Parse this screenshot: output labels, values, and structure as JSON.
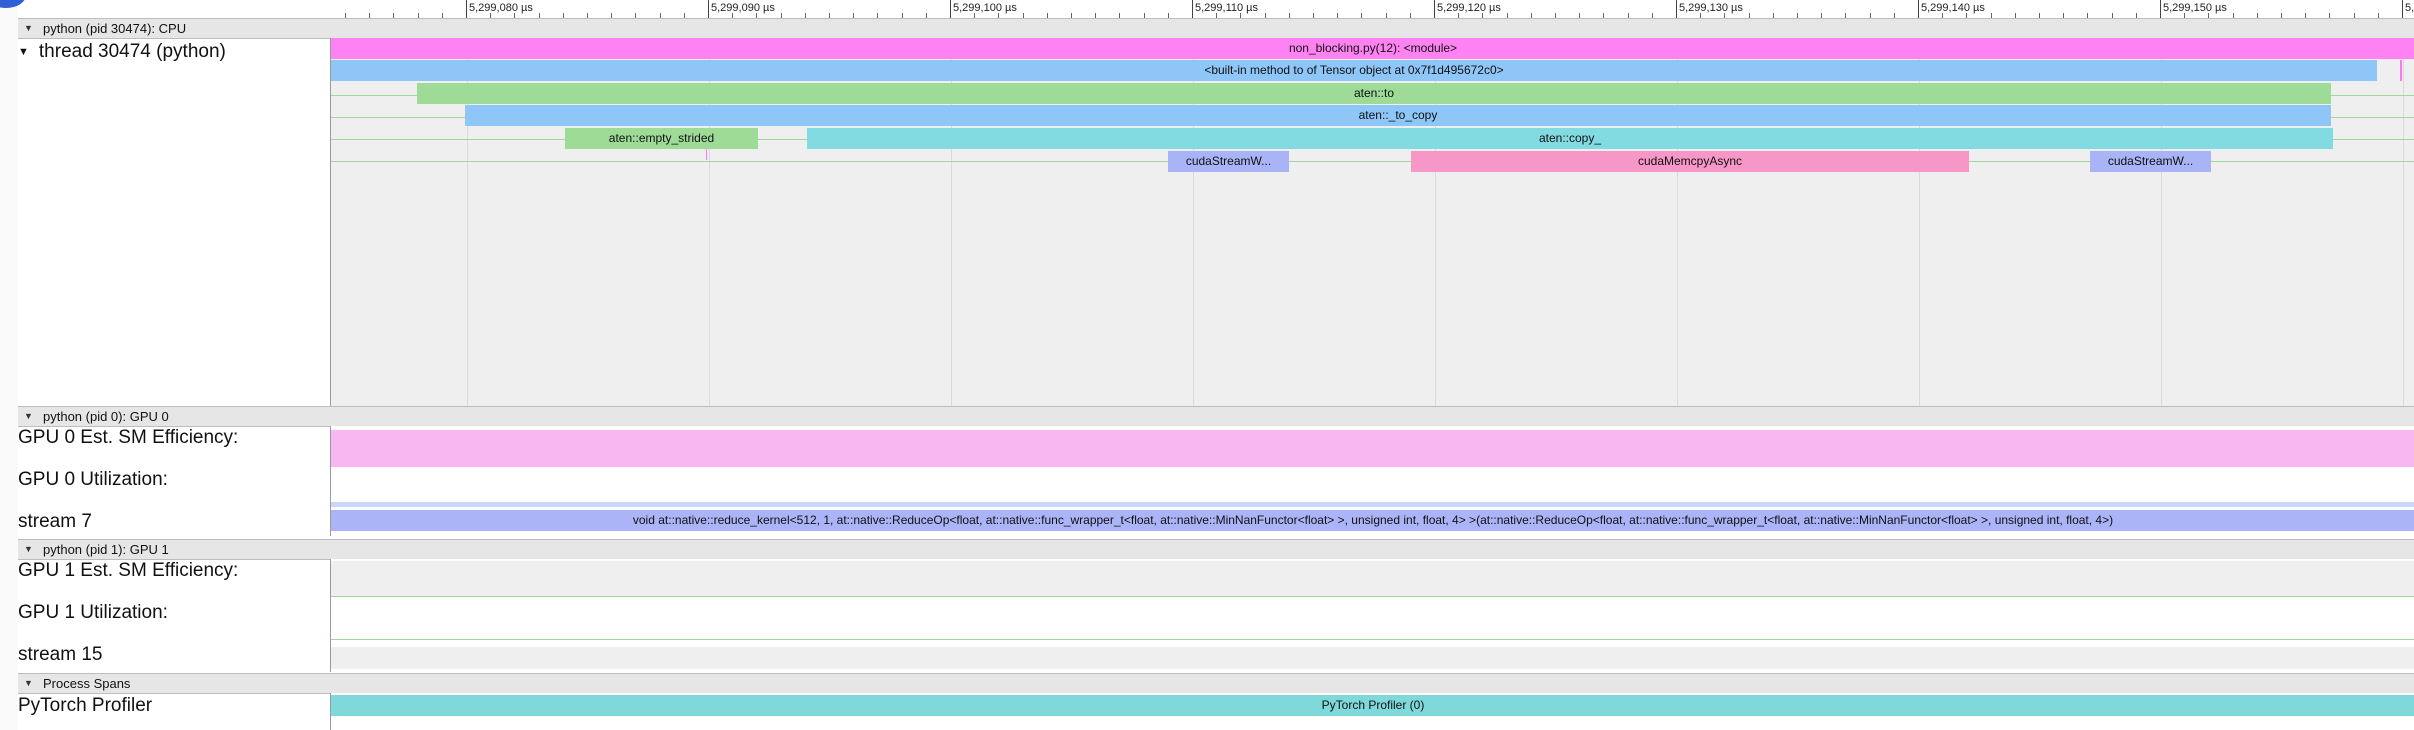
{
  "timeline": {
    "tick_labels": [
      "5,299,080 µs",
      "5,299,090 µs",
      "5,299,100 µs",
      "5,299,110 µs",
      "5,299,120 µs",
      "5,299,130 µs",
      "5,299,140 µs",
      "5,299,150 µs",
      "5,"
    ]
  },
  "sections": {
    "cpu": {
      "label": "python (pid 30474): CPU"
    },
    "gpu0": {
      "label": "python (pid 0): GPU 0"
    },
    "gpu1": {
      "label": "python (pid 1): GPU 1"
    },
    "spans": {
      "label": "Process Spans"
    }
  },
  "tracks": {
    "thread": {
      "label": "thread 30474 (python)"
    },
    "gpu0_sm": {
      "label": "GPU 0 Est. SM Efficiency:"
    },
    "gpu0_util": {
      "label": "GPU 0 Utilization:"
    },
    "stream7": {
      "label": "stream 7"
    },
    "gpu1_sm": {
      "label": "GPU 1 Est. SM Efficiency:"
    },
    "gpu1_util": {
      "label": "GPU 1 Utilization:"
    },
    "stream15": {
      "label": "stream 15"
    },
    "profiler": {
      "label": "PyTorch Profiler"
    }
  },
  "slices": {
    "module": "non_blocking.py(12): <module>",
    "to_method": "<built-in method to of Tensor object at 0x7f1d495672c0>",
    "aten_to": "aten::to",
    "aten_to_copy": "aten::_to_copy",
    "empty_strided": "aten::empty_strided",
    "aten_copy": "aten::copy_",
    "stream_wait_1": "cudaStreamW...",
    "memcpy_async": "cudaMemcpyAsync",
    "stream_wait_2": "cudaStreamW...",
    "reduce_kernel": "void at::native::reduce_kernel<512, 1, at::native::ReduceOp<float, at::native::func_wrapper_t<float, at::native::MinNanFunctor<float> >, unsigned int, float, 4> >(at::native::ReduceOp<float, at::native::func_wrapper_t<float, at::native::MinNanFunctor<float> >, unsigned int, float, 4>)",
    "profiler_span": "PyTorch Profiler (0)"
  },
  "colors": {
    "module": "#ff82f2",
    "to_method": "#8dc6f7",
    "aten_to": "#9ddb96",
    "aten_to_copy": "#8dc6f7",
    "empty_strided": "#9ddb96",
    "aten_copy": "#82dbe0",
    "stream_wait": "#a9b4f7",
    "memcpy_async": "#f797c8",
    "gpu0_sm_band": "#f9b7f2",
    "reduce_kernel": "#aab4f7",
    "profiler_span": "#7fd9db"
  }
}
